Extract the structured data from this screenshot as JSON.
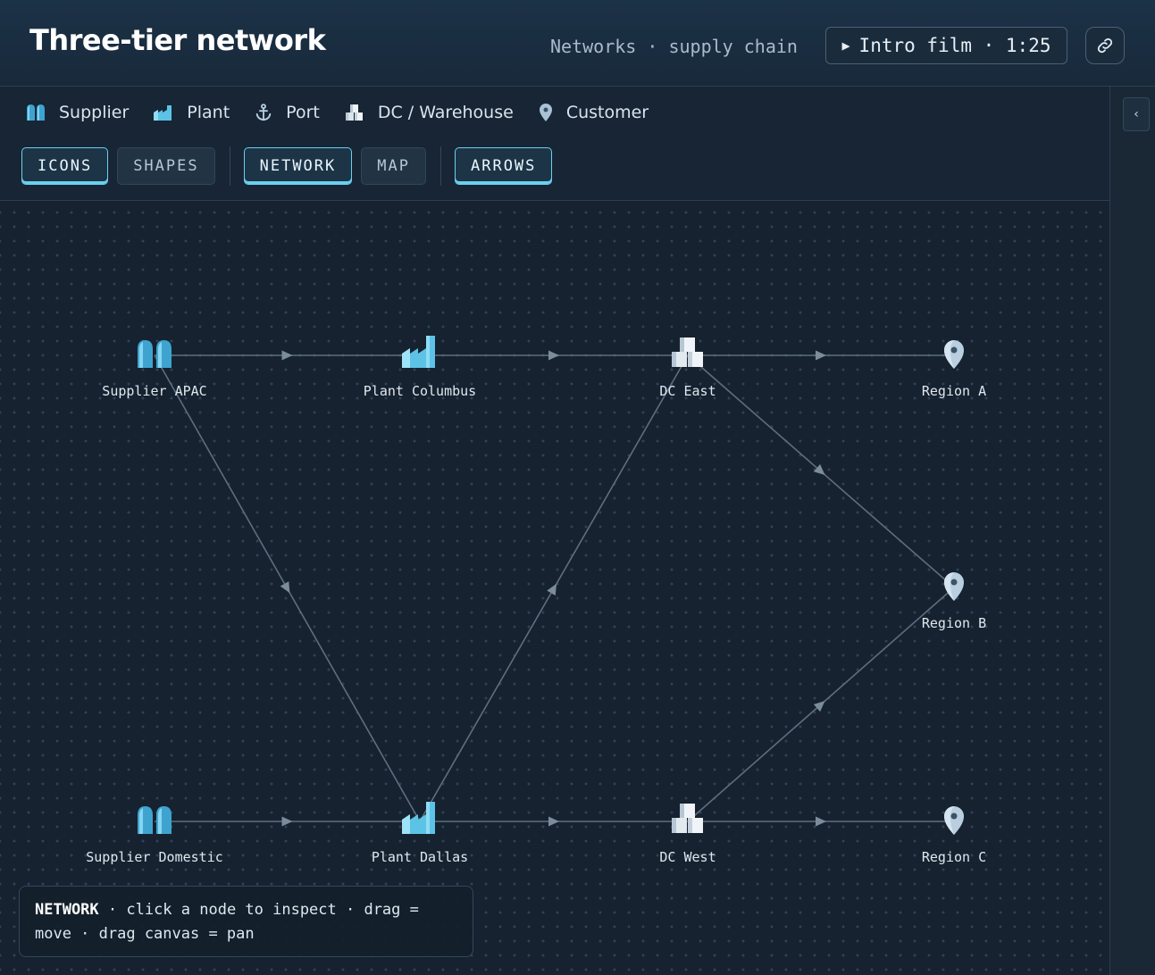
{
  "header": {
    "title": "Three-tier network",
    "breadcrumb": "Networks · supply chain",
    "film_button": "Intro film · 1:25",
    "play_glyph": "▶",
    "link_icon": "link-icon"
  },
  "legend": [
    {
      "label": "Supplier",
      "icon": "supplier-icon"
    },
    {
      "label": "Plant",
      "icon": "plant-icon"
    },
    {
      "label": "Port",
      "icon": "anchor-icon"
    },
    {
      "label": "DC / Warehouse",
      "icon": "warehouse-icon"
    },
    {
      "label": "Customer",
      "icon": "location-pin-icon"
    }
  ],
  "toolbar": {
    "icons": "ICONS",
    "shapes": "SHAPES",
    "network": "NETWORK",
    "map": "MAP",
    "arrows": "ARROWS",
    "active": [
      "ICONS",
      "NETWORK",
      "ARROWS"
    ]
  },
  "sidebar": {
    "collapse_glyph": "‹"
  },
  "network": {
    "nodes": [
      {
        "id": "supplier-apac",
        "label": "Supplier APAC",
        "type": "supplier"
      },
      {
        "id": "plant-columbus",
        "label": "Plant Columbus",
        "type": "plant"
      },
      {
        "id": "dc-east",
        "label": "DC East",
        "type": "dc"
      },
      {
        "id": "region-a",
        "label": "Region A",
        "type": "customer"
      },
      {
        "id": "region-b",
        "label": "Region B",
        "type": "customer"
      },
      {
        "id": "supplier-domestic",
        "label": "Supplier Domestic",
        "type": "supplier"
      },
      {
        "id": "plant-dallas",
        "label": "Plant Dallas",
        "type": "plant"
      },
      {
        "id": "dc-west",
        "label": "DC West",
        "type": "dc"
      },
      {
        "id": "region-c",
        "label": "Region C",
        "type": "customer"
      }
    ],
    "edges": [
      [
        "supplier-apac",
        "plant-columbus"
      ],
      [
        "plant-columbus",
        "dc-east"
      ],
      [
        "dc-east",
        "region-a"
      ],
      [
        "supplier-apac",
        "plant-dallas"
      ],
      [
        "dc-east",
        "region-b"
      ],
      [
        "plant-dallas",
        "dc-east"
      ],
      [
        "supplier-domestic",
        "plant-dallas"
      ],
      [
        "plant-dallas",
        "dc-west"
      ],
      [
        "dc-west",
        "region-c"
      ],
      [
        "dc-west",
        "region-b"
      ]
    ]
  },
  "hint": {
    "mode": "NETWORK",
    "text": " · click a node to inspect · drag = move · drag canvas = pan"
  },
  "colors": {
    "accent": "#6ad0ef",
    "plant": "#5cc3e6",
    "supplier": "#3ea4cf",
    "edge": "#5d6e7e",
    "pin": "#b9cfe0"
  }
}
